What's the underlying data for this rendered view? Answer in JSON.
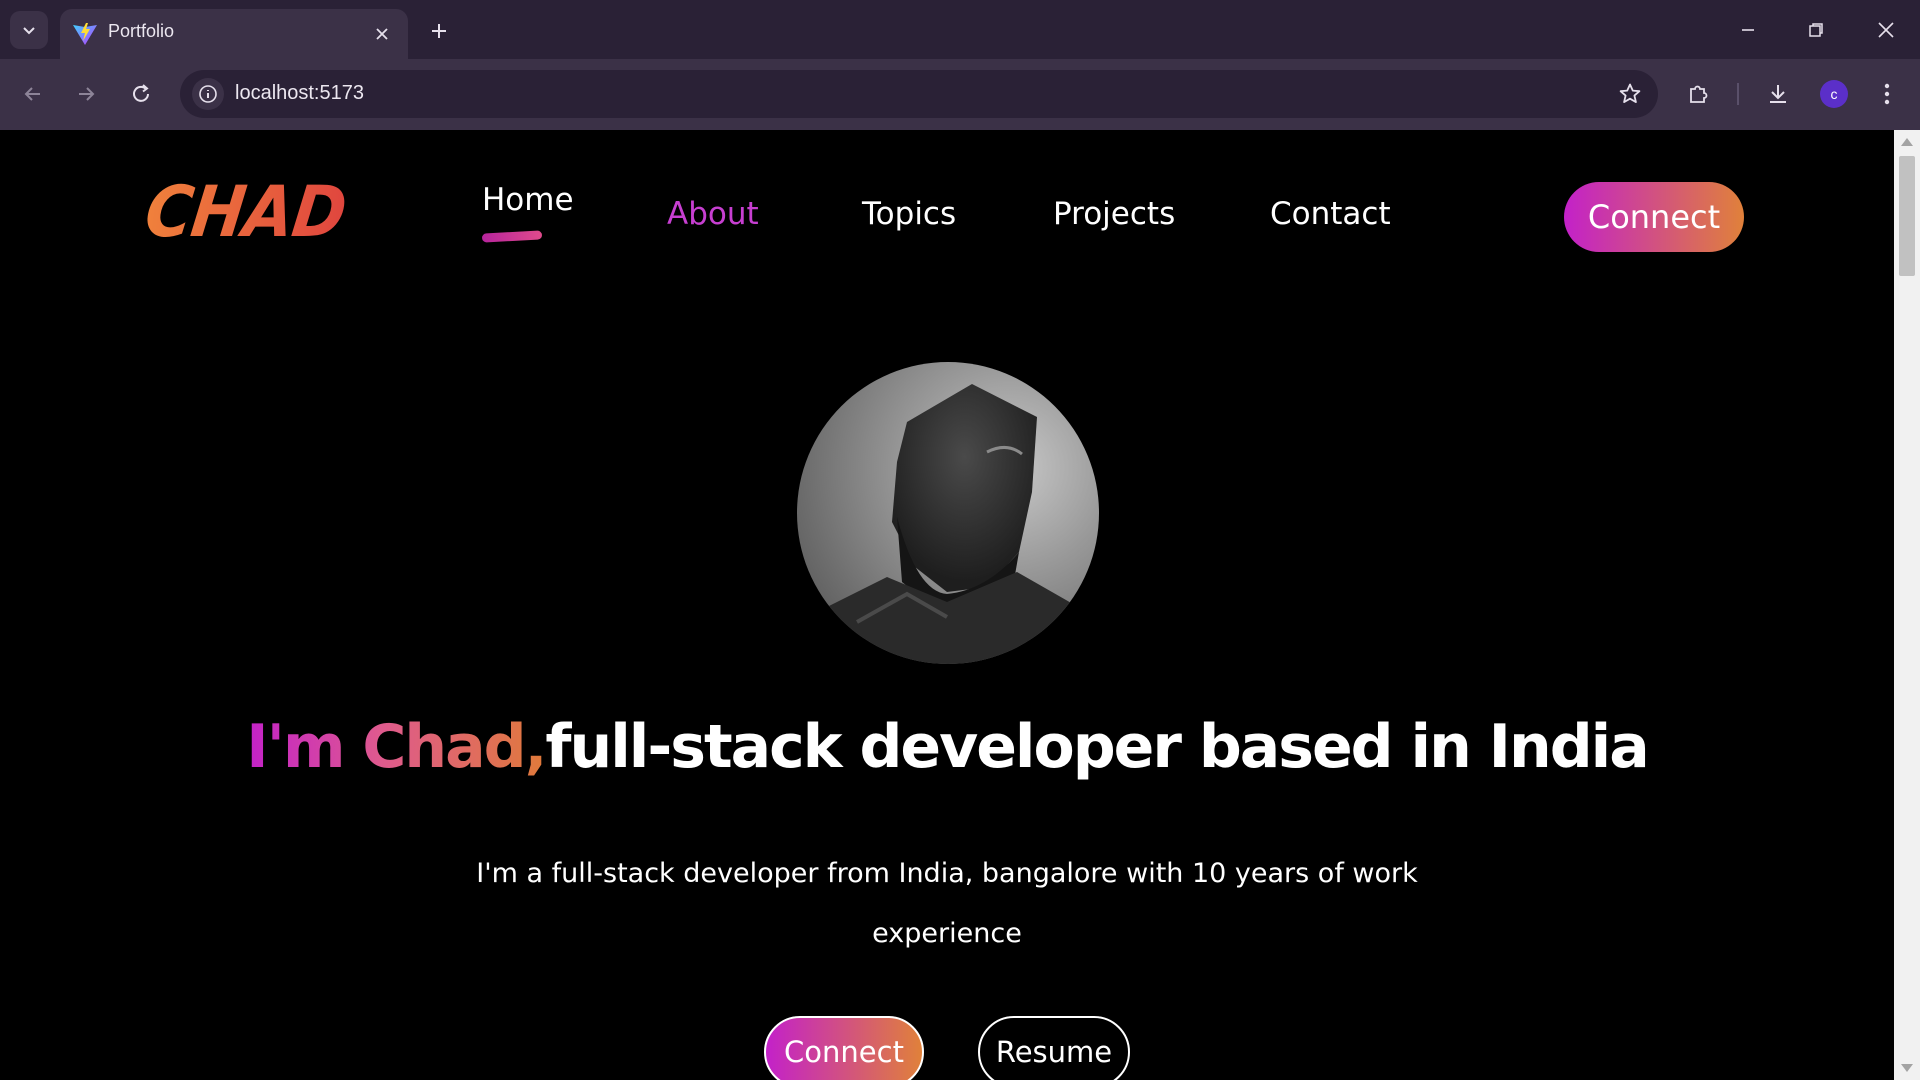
{
  "browser": {
    "tab_title": "Portfolio",
    "url": "localhost:5173",
    "profile_initial": "c"
  },
  "site": {
    "logo": "CHAD",
    "nav": [
      "Home",
      "About",
      "Topics",
      "Projects",
      "Contact"
    ],
    "active_nav": "Home",
    "hover_nav": "About",
    "connect_label": "Connect"
  },
  "hero": {
    "headline_accent": "I'm Chad,",
    "headline_rest": "full-stack developer based in India",
    "intro": "I'm a full-stack developer from India, bangalore with 10 years of work experience",
    "connect_label": "Connect",
    "resume_label": "Resume"
  },
  "colors": {
    "gradient_start": "#c321c9",
    "gradient_end": "#e0813a",
    "about_text": "#c73fd1",
    "background": "#000000",
    "browser_frame": "#2a2136"
  }
}
